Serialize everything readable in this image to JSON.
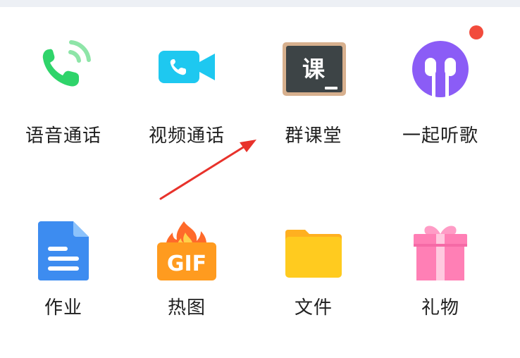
{
  "panel": {
    "items": [
      {
        "label": "语音通话",
        "icon": "phone-call-icon"
      },
      {
        "label": "视频通话",
        "icon": "video-call-icon"
      },
      {
        "label": "群课堂",
        "icon": "blackboard-class-icon",
        "icon_text": "课"
      },
      {
        "label": "一起听歌",
        "icon": "earphones-icon",
        "badge": true
      },
      {
        "label": "作业",
        "icon": "document-icon"
      },
      {
        "label": "热图",
        "icon": "gif-fire-icon",
        "icon_text": "GIF"
      },
      {
        "label": "文件",
        "icon": "folder-icon"
      },
      {
        "label": "礼物",
        "icon": "gift-icon"
      }
    ]
  },
  "colors": {
    "green": "#2fd46a",
    "cyan": "#1ec8f0",
    "purple": "#8b5cf6",
    "blue": "#3d8cf0",
    "orange": "#ff8c1a",
    "yellow": "#ffcb1f",
    "pink": "#ff7fb5",
    "badge": "#f24b3c",
    "arrow": "#e8322b"
  }
}
